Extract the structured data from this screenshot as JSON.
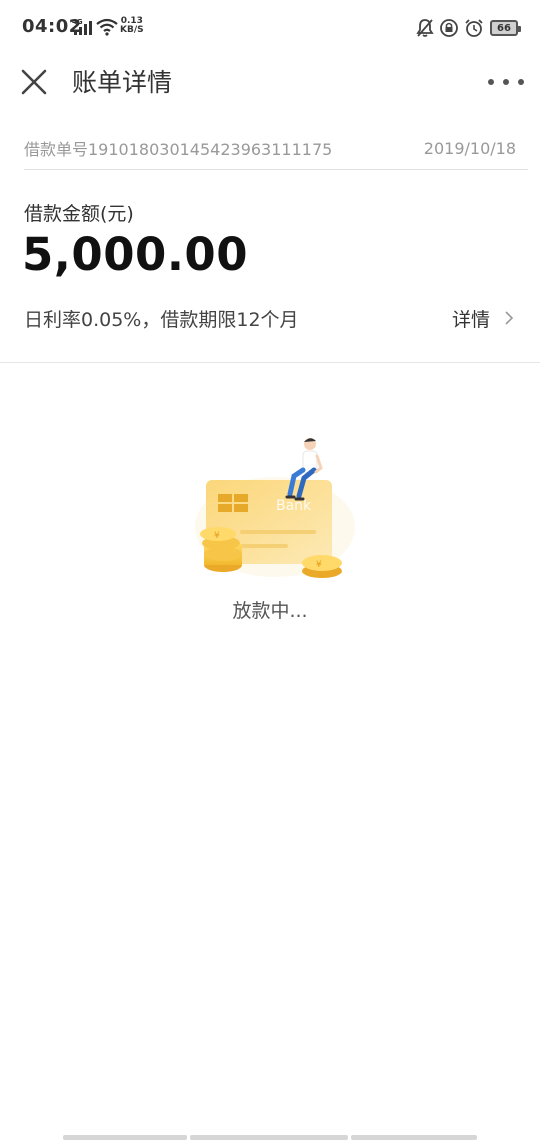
{
  "status_bar": {
    "time": "04:02",
    "network": "4G",
    "speed_value": "0.13",
    "speed_unit": "KB/S",
    "battery": "66"
  },
  "header": {
    "title": "账单详情"
  },
  "order": {
    "number_text": "借款单号191018030145423963111175",
    "date": "2019/10/18"
  },
  "loan": {
    "amount_label": "借款金额(元)",
    "amount_value": "5,000.00",
    "rate_text": "日利率0.05%，借款期限12个月",
    "detail_label": "详情"
  },
  "illustration": {
    "card_text": "Bank"
  },
  "status_message": "放款中...",
  "colors": {
    "accent_gold": "#f5c342",
    "card_gold": "#fbd77a",
    "text_muted": "#999999"
  }
}
